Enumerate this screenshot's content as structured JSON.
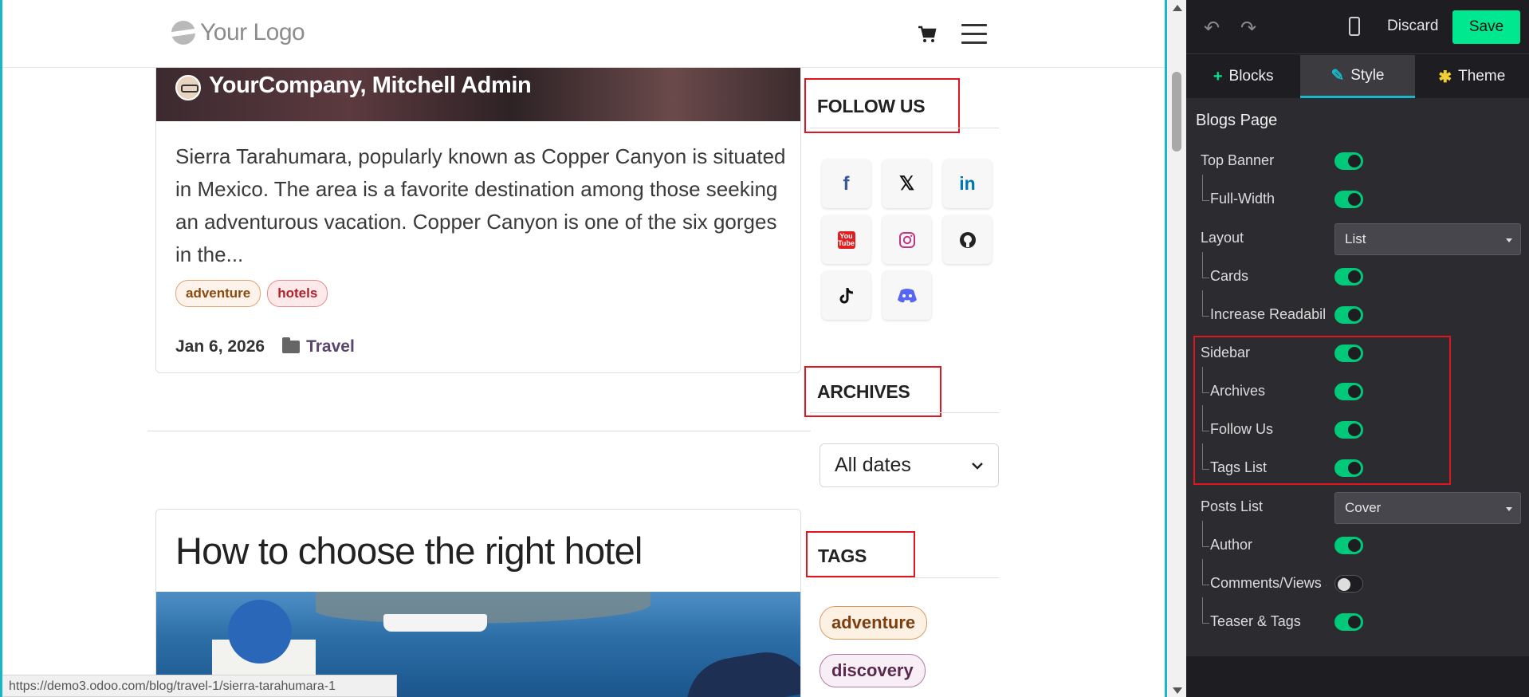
{
  "header": {
    "logo_text": "Your Logo",
    "cart_icon": "cart-icon",
    "menu_icon": "hamburger-menu-icon"
  },
  "post1": {
    "author": "YourCompany, Mitchell Admin",
    "excerpt": "Sierra Tarahumara, popularly known as Copper Canyon is situated in Mexico. The area is a favorite destination among those seeking an adventurous vacation. Copper Canyon is one of the six gorges in the...",
    "tags": [
      "adventure",
      "hotels"
    ],
    "date": "Jan 6, 2026",
    "category": "Travel"
  },
  "post2": {
    "title": "How to choose the right hotel"
  },
  "sidebar": {
    "follow_title": "FOLLOW US",
    "archives_title": "ARCHIVES",
    "archives_value": "All dates",
    "tags_title": "TAGS",
    "tags": [
      "adventure",
      "discovery"
    ],
    "social": [
      {
        "name": "facebook",
        "glyph": "f",
        "color": "#3b5998"
      },
      {
        "name": "x",
        "glyph": "𝕏",
        "color": "#111111"
      },
      {
        "name": "linkedin",
        "glyph": "in",
        "color": "#0077b5"
      },
      {
        "name": "youtube",
        "glyph": "You Tube",
        "color": "#e02020"
      },
      {
        "name": "instagram",
        "glyph": "◎",
        "color": "#c13584"
      },
      {
        "name": "github",
        "glyph": "●",
        "color": "#222222"
      },
      {
        "name": "tiktok",
        "glyph": "♪",
        "color": "#111111"
      },
      {
        "name": "discord",
        "glyph": "◉",
        "color": "#5865f2"
      }
    ]
  },
  "statusbar": {
    "url": "https://demo3.odoo.com/blog/travel-1/sierra-tarahumara-1"
  },
  "editor": {
    "toolbar": {
      "undo_icon": "undo-icon",
      "redo_icon": "redo-icon",
      "mobile_icon": "mobile-preview-icon",
      "discard_label": "Discard",
      "save_label": "Save"
    },
    "tabs": [
      {
        "label": "Blocks",
        "icon": "+"
      },
      {
        "label": "Style",
        "icon": "✎"
      },
      {
        "label": "Theme",
        "icon": "✱"
      }
    ],
    "panel_title": "Blogs Page",
    "options": {
      "top_banner": {
        "label": "Top Banner",
        "on": true
      },
      "full_width": {
        "label": "Full-Width",
        "on": true
      },
      "layout": {
        "label": "Layout",
        "value": "List"
      },
      "cards": {
        "label": "Cards",
        "on": true
      },
      "increase_readability": {
        "label": "Increase Readability",
        "on": true
      },
      "sidebar": {
        "label": "Sidebar",
        "on": true
      },
      "archives": {
        "label": "Archives",
        "on": true
      },
      "follow_us": {
        "label": "Follow Us",
        "on": true
      },
      "tags_list": {
        "label": "Tags List",
        "on": true
      },
      "posts_list": {
        "label": "Posts List",
        "value": "Cover"
      },
      "author": {
        "label": "Author",
        "on": true
      },
      "comments_views": {
        "label": "Comments/Views Stats",
        "on": false
      },
      "teaser_tags": {
        "label": "Teaser & Tags",
        "on": true
      }
    }
  },
  "colors": {
    "accent_teal": "#17b6c9",
    "save_green": "#00e88f",
    "highlight_red": "#e0151f"
  }
}
